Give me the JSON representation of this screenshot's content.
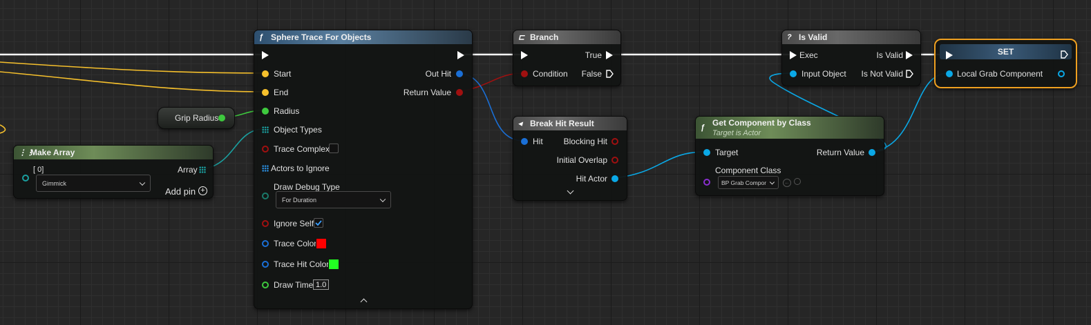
{
  "colors": {
    "exec": "#ffffff",
    "vector": "#f6c02c",
    "float": "#3ec93e",
    "boolean": "#a01010",
    "object": "#0aa8e6",
    "struct": "#1a6fd6",
    "array": "#1aa0a0",
    "class": "#8a2fd0",
    "selection": "#f0a020"
  },
  "sphere_trace": {
    "title": "Sphere Trace For Objects",
    "icon": "function-icon",
    "inputs": {
      "start": "Start",
      "end": "End",
      "radius": "Radius",
      "object_types": "Object Types",
      "trace_complex": "Trace Complex",
      "actors_to_ignore": "Actors to Ignore",
      "draw_debug_type": "Draw Debug Type",
      "draw_debug_value": "For Duration",
      "ignore_self": "Ignore Self",
      "trace_color": "Trace Color",
      "trace_hit_color": "Trace Hit Color",
      "draw_time": "Draw Time",
      "draw_time_value": "1.0"
    },
    "outputs": {
      "out_hit": "Out Hit",
      "return_value": "Return Value"
    },
    "trace_color_hex": "#ff0000",
    "trace_hit_color_hex": "#22ff22",
    "ignore_self_checked": true,
    "trace_complex_checked": false
  },
  "grip_radius": {
    "label": "Grip Radius"
  },
  "make_array": {
    "title": "Make Array",
    "index_label": "[ 0]",
    "value": "Gimmick",
    "output": "Array",
    "add_pin": "Add pin"
  },
  "branch": {
    "title": "Branch",
    "condition": "Condition",
    "true_label": "True",
    "false_label": "False"
  },
  "break_hit": {
    "title": "Break Hit Result",
    "hit": "Hit",
    "blocking_hit": "Blocking Hit",
    "initial_overlap": "Initial Overlap",
    "hit_actor": "Hit Actor"
  },
  "is_valid": {
    "title": "Is Valid",
    "icon": "?",
    "exec": "Exec",
    "input_object": "Input Object",
    "is_valid": "Is Valid",
    "is_not_valid": "Is Not Valid"
  },
  "get_component": {
    "title": "Get Component by Class",
    "subtitle": "Target is Actor",
    "target": "Target",
    "return_value": "Return Value",
    "component_class": "Component Class",
    "class_value": "BP Grab Compor"
  },
  "set_node": {
    "title": "SET",
    "variable": "Local Grab Component"
  }
}
